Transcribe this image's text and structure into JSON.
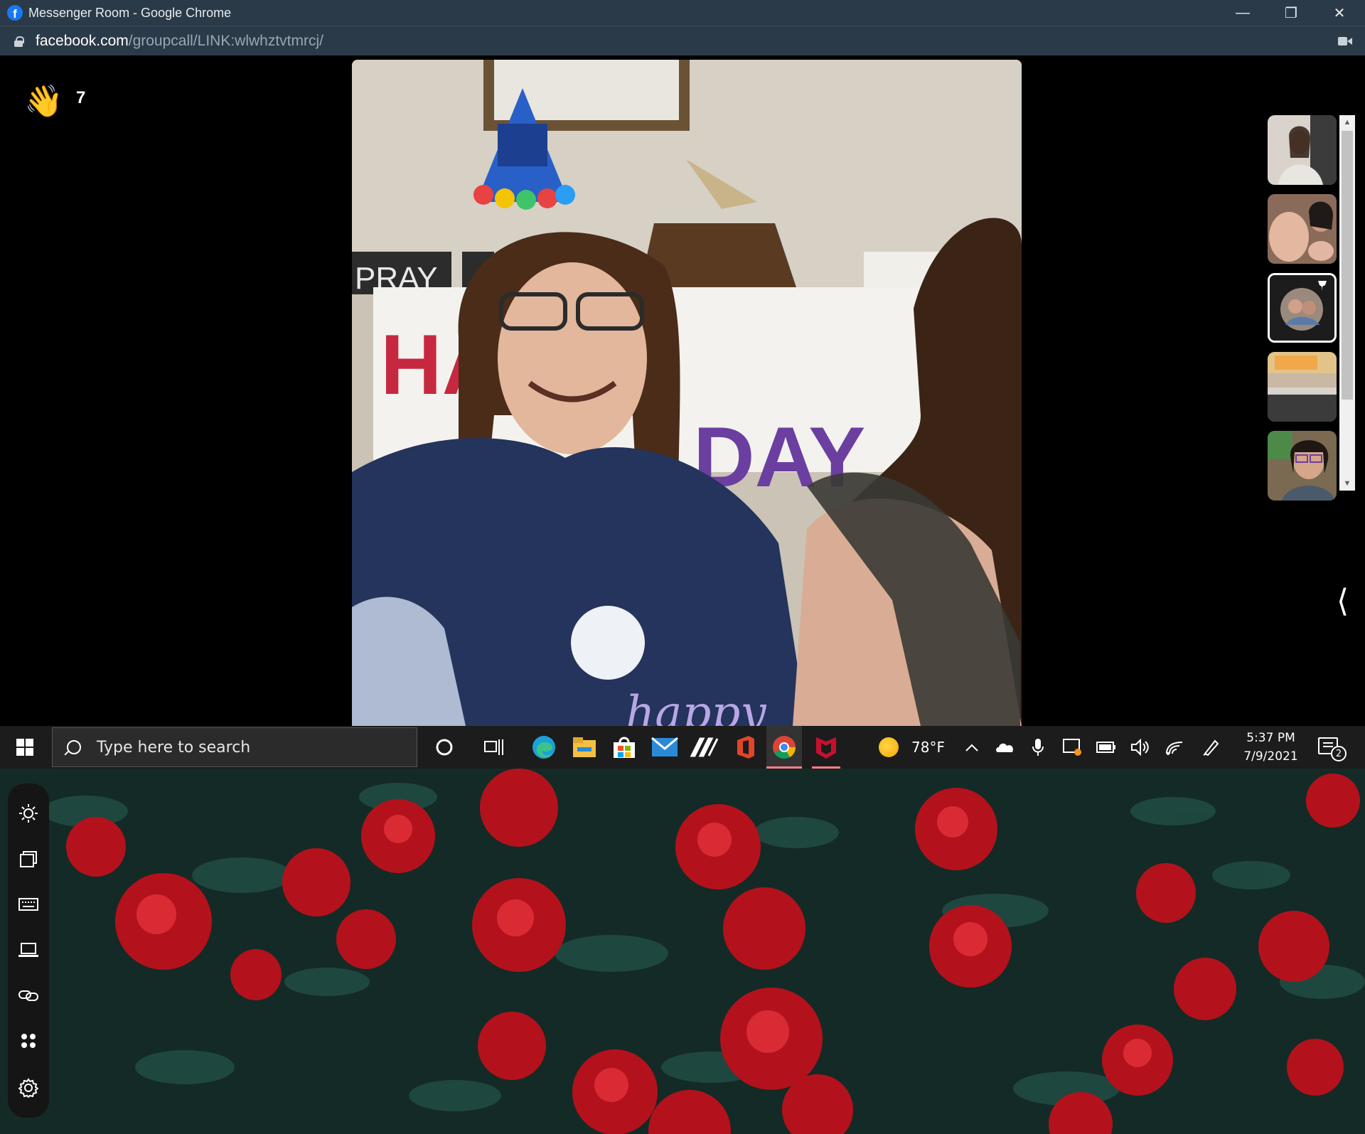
{
  "window": {
    "title": "Messenger Room - Google Chrome",
    "favicon_letter": "f",
    "controls": {
      "minimize": "—",
      "restore": "❐",
      "close": "✕"
    }
  },
  "address_bar": {
    "url_domain": "facebook.com",
    "url_path": "/groupcall/LINK:wlwhztvtmrcj/"
  },
  "call": {
    "wave_emoji": "👋",
    "wave_count": "7",
    "video_text": {
      "pray_sign": "PRAY",
      "banner_top": "HAPPY",
      "banner_bottom": "DAY",
      "overlay_caption": "happy"
    },
    "collapse_glyph": "⟨"
  },
  "scrollbar": {
    "up": "▲",
    "down": "▼"
  },
  "taskbar": {
    "search_placeholder": "Type here to search",
    "weather_temp": "78°F",
    "time": "5:37 PM",
    "date": "7/9/2021",
    "notification_count": "2"
  },
  "colors": {
    "titlebar": "#2b3a48",
    "taskbar": "#1c1c1c",
    "facebook_blue": "#1877f2",
    "active_app_underline": "#ff7e8a"
  }
}
